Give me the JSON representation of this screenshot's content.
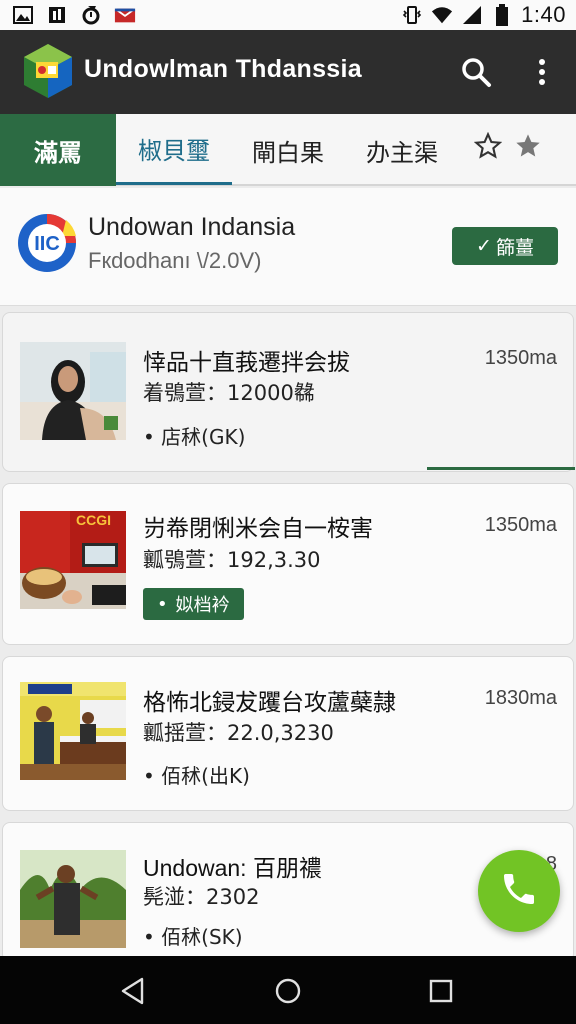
{
  "status_bar": {
    "time": "1:40",
    "icons_left": [
      "image-icon",
      "sim-icon",
      "sync-icon",
      "mail-icon"
    ],
    "icons_right": [
      "vibrate-icon",
      "wifi-icon",
      "signal-icon",
      "battery-icon"
    ]
  },
  "app_bar": {
    "title": "Undowlman Thdanssia",
    "actions": [
      "search-icon",
      "more-vert-icon"
    ]
  },
  "tabs": {
    "items": [
      {
        "label": "滿罵"
      },
      {
        "label": "椒貝璽"
      },
      {
        "label": "閘白果"
      },
      {
        "label": "办主渠"
      }
    ],
    "active_index": 0,
    "selected_index": 1,
    "star_icons": [
      "star-outline-icon",
      "star-filled-icon"
    ]
  },
  "profile": {
    "name": "Undowan Indansia",
    "subtitle": "Fкdodhanı \\/2.0V)",
    "follow_label": "篩薑",
    "logo_text": "IIC"
  },
  "list": {
    "items": [
      {
        "title": "悻品十直莪遷拌会拔",
        "meta": "着鴞萱：12000㣈",
        "location": "店秫(GK)",
        "duration": "1350ma",
        "progress": 0.26
      },
      {
        "title": "岃帣閉悧米会自一桉害",
        "meta": "瓤鴞萱：192,3.30",
        "badge": "姒档衿",
        "duration": "1350ma",
        "thumb_text": "CCGI"
      },
      {
        "title": "格怖北鋟犮躩台攻蘆蘗隷",
        "meta": "瓤揺萱：22.0,3230",
        "location": "佰秫(出K)",
        "duration": "1830ma"
      },
      {
        "title": "Undowan: 百朋禯",
        "meta": "髡湴：2302",
        "location": "佰秫(SK)",
        "duration": "1…8"
      }
    ]
  },
  "fab": {
    "icon": "phone-icon"
  },
  "nav_bar": {
    "buttons": [
      "back-icon",
      "home-icon",
      "recents-icon"
    ]
  },
  "colors": {
    "app_bar": "#2d2d2d",
    "accent_green": "#2b6a41",
    "tab_blue": "#1f6d8b",
    "fab_green": "#72c425"
  }
}
